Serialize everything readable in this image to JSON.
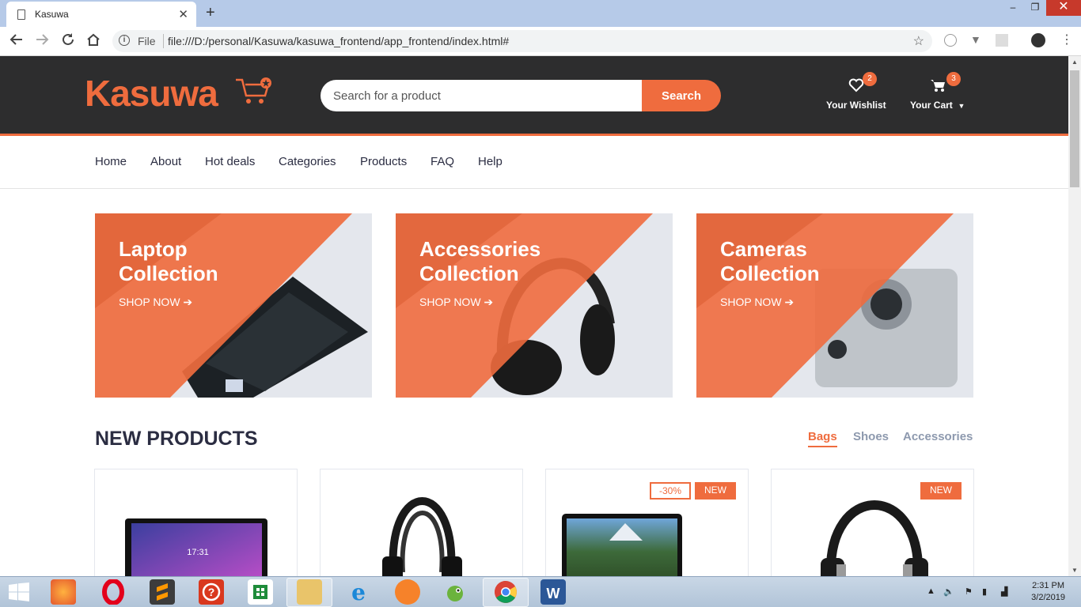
{
  "browser": {
    "tab_title": "Kasuwa",
    "close_tab": "✕",
    "new_tab": "+",
    "win_min": "–",
    "win_max": "❐",
    "win_close": "✕",
    "security_label": "File",
    "url": "file:///D:/personal/Kasuwa/kasuwa_frontend/app_frontend/index.html#"
  },
  "header": {
    "logo": "Kasuwa",
    "search_placeholder": "Search for a product",
    "search_button": "Search",
    "wishlist": {
      "label": "Your Wishlist",
      "count": "2"
    },
    "cart": {
      "label": "Your Cart",
      "count": "3"
    }
  },
  "nav": {
    "items": [
      "Home",
      "About",
      "Hot deals",
      "Categories",
      "Products",
      "FAQ",
      "Help"
    ]
  },
  "collections": [
    {
      "title": "Laptop\nCollection",
      "cta": "SHOP NOW"
    },
    {
      "title": "Accessories\nCollection",
      "cta": "SHOP NOW"
    },
    {
      "title": "Cameras\nCollection",
      "cta": "SHOP NOW"
    }
  ],
  "new_products": {
    "title": "NEW PRODUCTS",
    "tabs": [
      "Bags",
      "Shoes",
      "Accessories"
    ],
    "active_tab": "Bags",
    "cards": [
      {
        "product": "tablet",
        "badges": []
      },
      {
        "product": "headphones",
        "badges": []
      },
      {
        "product": "laptop",
        "badges": [
          "-30%",
          "NEW"
        ]
      },
      {
        "product": "headphones",
        "badges": [
          "NEW"
        ]
      }
    ],
    "tablet_clock": "17:31"
  },
  "taskbar": {
    "time": "2:31 PM",
    "date": "3/2/2019"
  },
  "colors": {
    "accent": "#ef6c3e",
    "header_bg": "#2d2d2e",
    "text_dark": "#2b2d42",
    "muted": "#8d99ae"
  }
}
